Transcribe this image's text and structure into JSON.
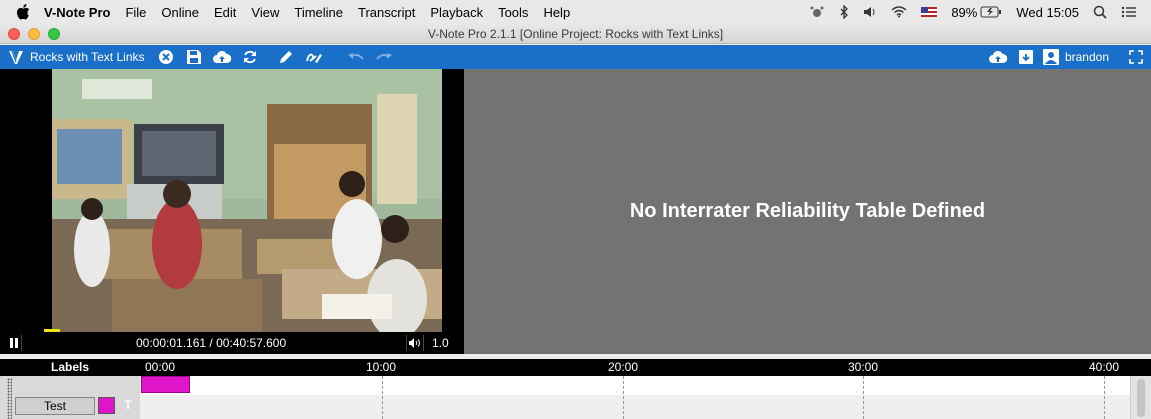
{
  "menubar": {
    "app_name": "V-Note Pro",
    "items": [
      "File",
      "Online",
      "Edit",
      "View",
      "Timeline",
      "Transcript",
      "Playback",
      "Tools",
      "Help"
    ],
    "battery": "89%",
    "clock": "Wed 15:05",
    "icons": [
      "apple-icon",
      "activity-icon",
      "bluetooth-icon",
      "volume-icon",
      "wifi-icon",
      "us-flag-icon",
      "battery-icon",
      "spotlight-search-icon",
      "notification-center-icon"
    ]
  },
  "window": {
    "title": "V-Note Pro 2.1.1 [Online Project: Rocks with Text Links]"
  },
  "toolbar": {
    "project_name": "Rocks with Text Links",
    "username": "brandon",
    "accent_color": "#1a6fc9",
    "icons": [
      "vnote-logo-icon",
      "close-project-icon",
      "save-icon",
      "cloud-upload-icon",
      "sync-icon",
      "pen-icon",
      "highlighter-icon",
      "undo-icon",
      "redo-icon",
      "cloud-upload-icon",
      "archive-download-icon",
      "user-icon",
      "fullscreen-icon"
    ]
  },
  "player": {
    "current_time": "00:00:01.161",
    "total_time": "/ 00:40:57.600",
    "speed": "1.0"
  },
  "right_panel": {
    "message": "No Interrater Reliability Table Defined"
  },
  "timeline": {
    "labels_header": "Labels",
    "ticks": [
      "00:00",
      "10:00",
      "20:00",
      "30:00",
      "40:00"
    ],
    "tracks": [
      {
        "label": "Test",
        "color": "#e014c8",
        "toggle": "T"
      }
    ]
  }
}
